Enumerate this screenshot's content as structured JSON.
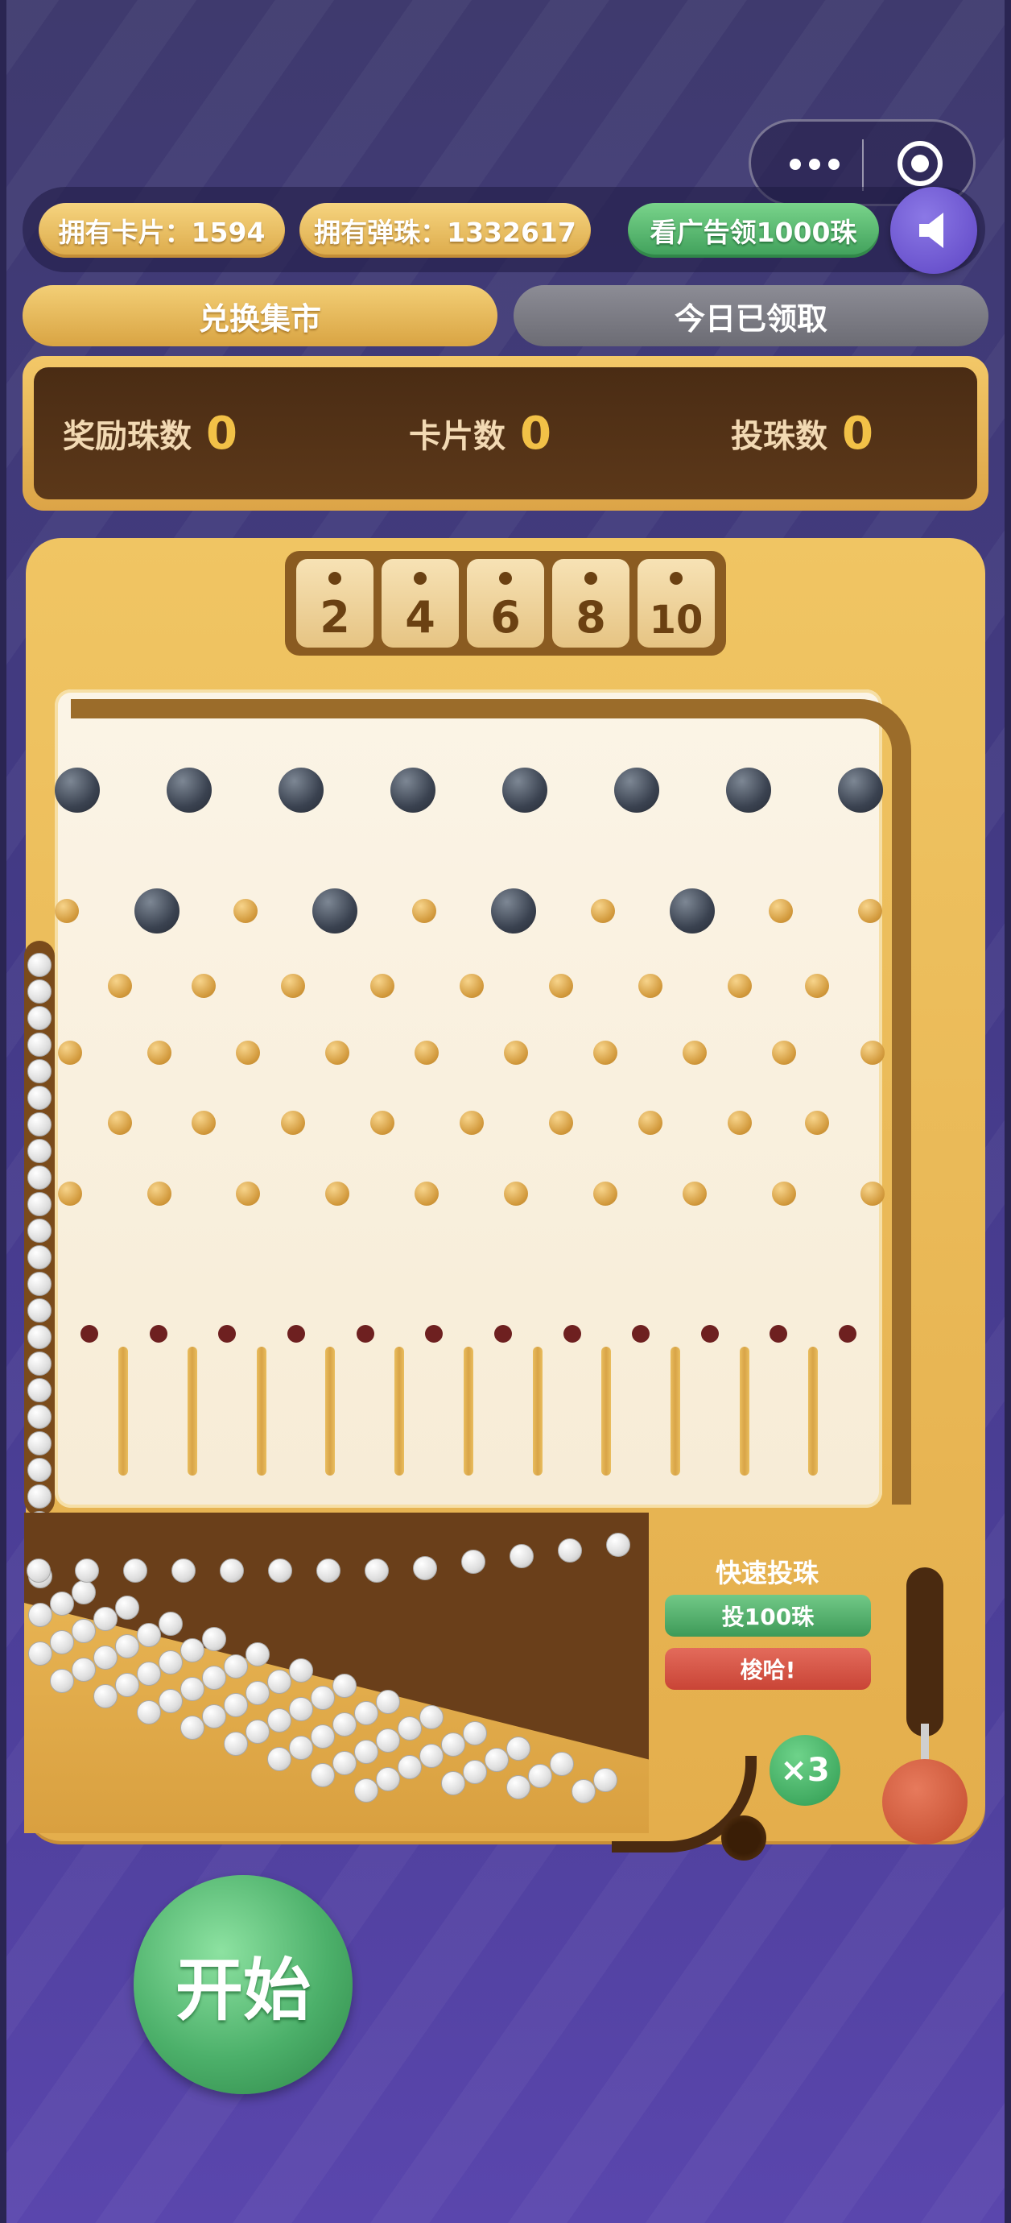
{
  "header": {
    "cards_label": "拥有卡片：1594",
    "marbles_label": "拥有弹珠：1332617",
    "ad_button": "看广告领1000珠",
    "sound_icon": "speaker-icon"
  },
  "capsule": {
    "more_icon": "more-dots-icon",
    "close_icon": "target-close-icon"
  },
  "tabs": {
    "market": "兑换集市",
    "claimed": "今日已领取"
  },
  "stats": {
    "reward_label": "奖励珠数",
    "reward_value": "0",
    "cards_label": "卡片数",
    "cards_value": "0",
    "bet_label": "投珠数",
    "bet_value": "0"
  },
  "slots": [
    "2",
    "4",
    "6",
    "8",
    "10"
  ],
  "quick_bet": {
    "title": "快速投珠",
    "bet100": "投100珠",
    "allin": "梭哈!"
  },
  "multiplier": "×3",
  "start_button": "开始",
  "colors": {
    "board": "#E4AE4C",
    "start": "#4CB06A",
    "bg": "#433A86"
  }
}
